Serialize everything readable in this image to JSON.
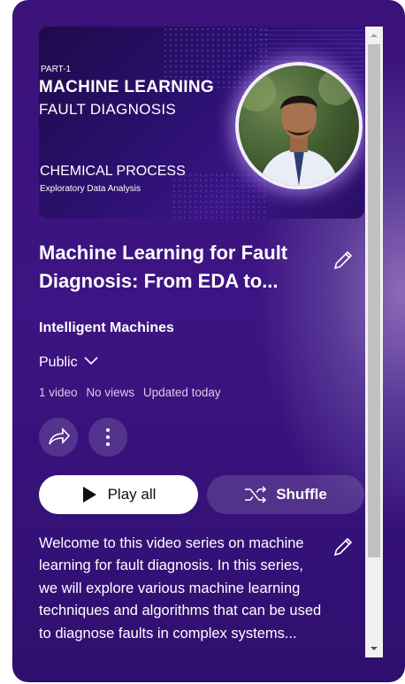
{
  "thumbnail": {
    "part": "PART-1",
    "title_line1": "MACHINE LEARNING",
    "title_line2": "FAULT DIAGNOSIS",
    "subtitle_line1": "CHEMICAL PROCESS",
    "subtitle_line2": "Exploratory Data Analysis"
  },
  "playlist": {
    "title": "Machine Learning for Fault Diagnosis: From EDA to...",
    "channel": "Intelligent Machines",
    "visibility": "Public",
    "video_count": "1 video",
    "views": "No views",
    "updated": "Updated today",
    "description": "Welcome to this video series on machine learning for fault diagnosis. In this series, we will explore various machine learning techniques and algorithms that can be used to diagnose faults in complex systems..."
  },
  "actions": {
    "play_all": "Play all",
    "shuffle": "Shuffle"
  },
  "icons": [
    "edit-icon",
    "chevron-down-icon",
    "share-icon",
    "more-icon",
    "play-icon",
    "shuffle-icon"
  ],
  "colors": {
    "panel": "#3a1278",
    "play_button": "#ffffff",
    "secondary_button": "#5a3a8e"
  }
}
